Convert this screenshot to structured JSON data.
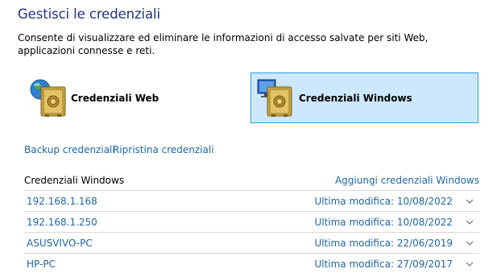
{
  "header": {
    "title": "Gestisci le credenziali",
    "description": "Consente di visualizzare ed eliminare le informazioni di accesso salvate per siti Web, applicazioni connesse e reti."
  },
  "tiles": {
    "web": {
      "label": "Credenziali Web",
      "icon": "web-vault-icon"
    },
    "windows": {
      "label": "Credenziali Windows",
      "icon": "windows-vault-icon",
      "selected": true
    }
  },
  "links": {
    "backup": "Backup credenziali",
    "restore": "Ripristina credenziali"
  },
  "section": {
    "title": "Credenziali Windows",
    "add_link": "Aggiungi credenziali Windows"
  },
  "credentials": [
    {
      "name": "192.168.1.168",
      "meta_label": "Ultima modifica:",
      "date": "10/08/2022"
    },
    {
      "name": "192.168.1.250",
      "meta_label": "Ultima modifica:",
      "date": "10/08/2022"
    },
    {
      "name": "ASUSVIVO-PC",
      "meta_label": "Ultima modifica:",
      "date": "22/06/2019"
    },
    {
      "name": "HP-PC",
      "meta_label": "Ultima modifica:",
      "date": "27/09/2017"
    }
  ],
  "colors": {
    "title": "#1e3287",
    "link": "#1e66a9",
    "selected_bg": "#cde8fc",
    "selected_border": "#26a0da",
    "divider": "#d9d9d9"
  }
}
